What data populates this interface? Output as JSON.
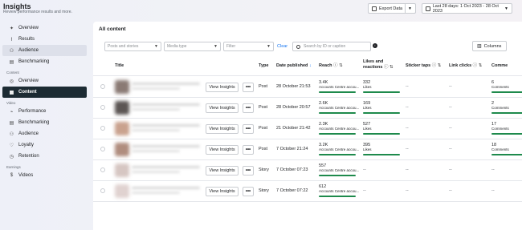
{
  "header": {
    "title": "Insights",
    "subtitle": "Review performance results and more.",
    "export_label": "Export Data",
    "date_range_label": "Last 28 days: 1 Oct 2023 - 28 Oct 2023"
  },
  "sidebar": {
    "top_items": [
      {
        "label": "Overview",
        "icon": "sparkle-icon"
      },
      {
        "label": "Results",
        "icon": "chart-icon"
      },
      {
        "label": "Audience",
        "icon": "people-icon"
      },
      {
        "label": "Benchmarking",
        "icon": "bars-icon"
      }
    ],
    "content_section": "Content",
    "content_items": [
      {
        "label": "Overview"
      },
      {
        "label": "Content"
      }
    ],
    "video_section": "Video",
    "video_items": [
      {
        "label": "Performance"
      },
      {
        "label": "Benchmarking"
      },
      {
        "label": "Audience"
      },
      {
        "label": "Loyalty"
      },
      {
        "label": "Retention"
      }
    ],
    "earnings_section": "Earnings",
    "earnings_items": [
      {
        "label": "Videos"
      }
    ]
  },
  "content": {
    "title": "All content",
    "filters": {
      "posts_placeholder": "Posts and stories",
      "media_placeholder": "Media type",
      "filter_placeholder": "Filter",
      "clear_label": "Clear",
      "search_placeholder": "Search by ID or caption",
      "columns_label": "Columns"
    },
    "columns": {
      "title": "Title",
      "type": "Type",
      "date": "Date published",
      "reach": "Reach",
      "likes": "Likes and",
      "likes2": "reactions",
      "sticker": "Sticker taps",
      "link": "Link clicks",
      "comments": "Comme"
    },
    "view_insights_label": "View Insights",
    "more_label": "•••",
    "rows": [
      {
        "type": "Post",
        "date": "28 October 21:53",
        "reach": "3.4K",
        "reach_sub": "Accounts Centre accou...",
        "likes": "332",
        "likes_sub": "Likes",
        "sticker": "--",
        "link": "--",
        "comments": "6",
        "comments_sub": "Comments",
        "thumb": "#8a7a74"
      },
      {
        "type": "Post",
        "date": "28 October 20:57",
        "reach": "2.6K",
        "reach_sub": "Accounts Centre accou...",
        "likes": "169",
        "likes_sub": "Likes",
        "sticker": "--",
        "link": "--",
        "comments": "2",
        "comments_sub": "Comments",
        "thumb": "#5c5654"
      },
      {
        "type": "Post",
        "date": "21 October 21:42",
        "reach": "2.3K",
        "reach_sub": "Accounts Centre accou...",
        "likes": "527",
        "likes_sub": "Likes",
        "sticker": "--",
        "link": "--",
        "comments": "17",
        "comments_sub": "Comments",
        "thumb": "#c9a28e"
      },
      {
        "type": "Post",
        "date": "7 October 21:24",
        "reach": "3.2K",
        "reach_sub": "Accounts Centre accou...",
        "likes": "395",
        "likes_sub": "Likes",
        "sticker": "--",
        "link": "--",
        "comments": "18",
        "comments_sub": "Comments",
        "thumb": "#b08d7e"
      },
      {
        "type": "Story",
        "date": "7 October 07:23",
        "reach": "557",
        "reach_sub": "Accounts Centre accou...",
        "likes": "--",
        "likes_sub": "",
        "sticker": "--",
        "link": "--",
        "comments": "--",
        "comments_sub": "",
        "thumb": "#d6c6c2"
      },
      {
        "type": "Story",
        "date": "7 October 07:22",
        "reach": "612",
        "reach_sub": "Accounts Centre accou...",
        "likes": "--",
        "likes_sub": "",
        "sticker": "--",
        "link": "--",
        "comments": "--",
        "comments_sub": "",
        "thumb": "#e0d2d0"
      }
    ]
  }
}
